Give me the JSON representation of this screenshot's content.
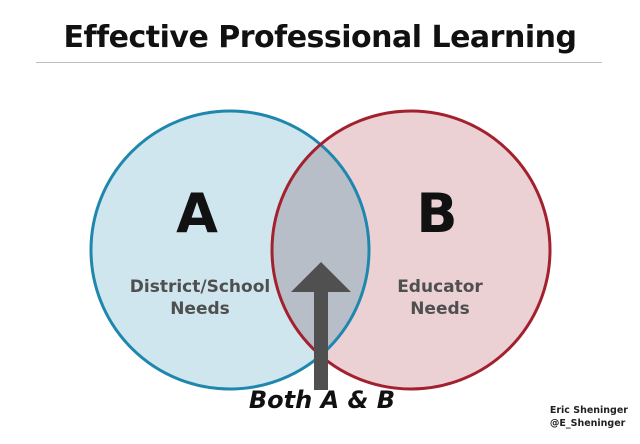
{
  "title": "Effective Professional Learning",
  "circle_a": {
    "letter": "A",
    "label_line1": "District/School",
    "label_line2": "Needs",
    "fill": "#cfe6ee",
    "stroke": "#1f87ad"
  },
  "circle_b": {
    "letter": "B",
    "label_line1": "Educator",
    "label_line2": "Needs",
    "fill": "#ecd1d4",
    "stroke": "#a3212e"
  },
  "overlap": {
    "fill": "#b8bec8",
    "arrow_color": "#505050"
  },
  "caption": "Both A & B",
  "credit": {
    "name": "Eric Sheninger",
    "handle": "@E_Sheninger"
  }
}
